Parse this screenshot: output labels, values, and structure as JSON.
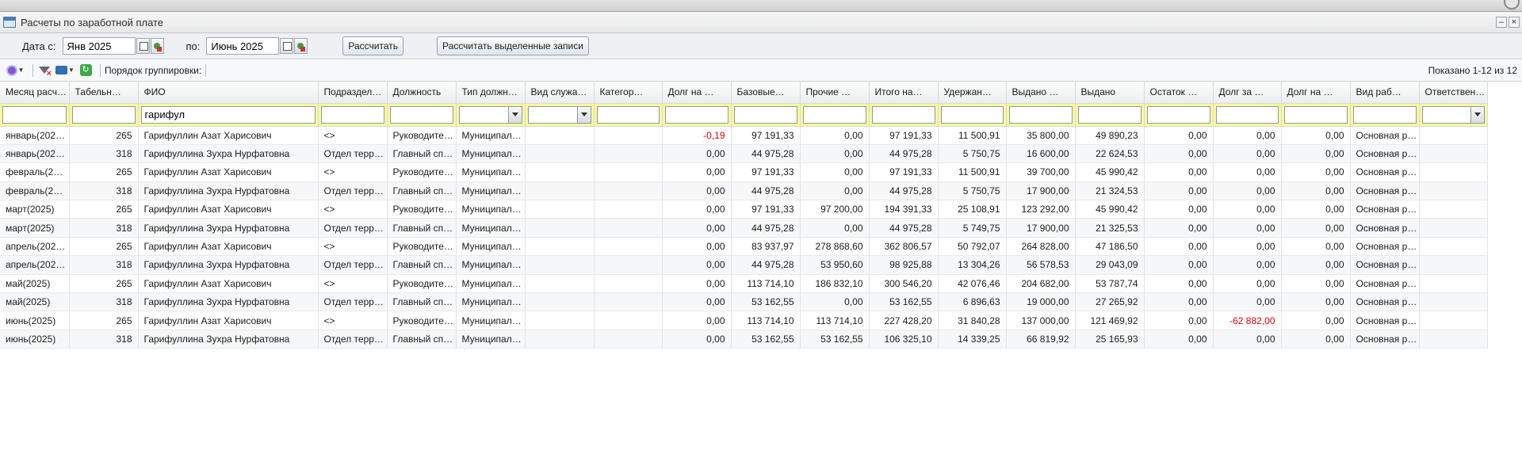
{
  "window": {
    "title": "Расчеты по заработной плате"
  },
  "dates": {
    "from_label": "Дата с:",
    "from_value": "Янв 2025",
    "to_label": "по:",
    "to_value": "Июнь 2025",
    "calc_button": "Рассчитать",
    "calc_selected_button": "Рассчитать выделенные записи"
  },
  "toolbar": {
    "grouping_label": "Порядок группировки:",
    "shown": "Показано 1-12 из 12"
  },
  "columns": [
    {
      "label": "Месяц расч…",
      "filter": "text",
      "value": ""
    },
    {
      "label": "Табельн…",
      "filter": "text",
      "value": ""
    },
    {
      "label": "ФИО",
      "filter": "text",
      "value": "гарифул"
    },
    {
      "label": "Подраздел…",
      "filter": "text",
      "value": ""
    },
    {
      "label": "Должность",
      "filter": "text",
      "value": ""
    },
    {
      "label": "Тип должн…",
      "filter": "select",
      "value": ""
    },
    {
      "label": "Вид служа…",
      "filter": "select",
      "value": ""
    },
    {
      "label": "Категор…",
      "filter": "text",
      "value": ""
    },
    {
      "label": "Долг на …",
      "filter": "text",
      "value": ""
    },
    {
      "label": "Базовые…",
      "filter": "text",
      "value": ""
    },
    {
      "label": "Прочие …",
      "filter": "text",
      "value": ""
    },
    {
      "label": "Итого на…",
      "filter": "text",
      "value": ""
    },
    {
      "label": "Удержан…",
      "filter": "text",
      "value": ""
    },
    {
      "label": "Выдано …",
      "filter": "text",
      "value": ""
    },
    {
      "label": "Выдано",
      "filter": "text",
      "value": ""
    },
    {
      "label": "Остаток …",
      "filter": "text",
      "value": ""
    },
    {
      "label": "Долг за …",
      "filter": "text",
      "value": ""
    },
    {
      "label": "Долг на …",
      "filter": "text",
      "value": ""
    },
    {
      "label": "Вид раб…",
      "filter": "text",
      "value": ""
    },
    {
      "label": "Ответствен…",
      "filter": "select",
      "value": ""
    }
  ],
  "rows": [
    [
      "январь(202…",
      "265",
      "Гарифуллин Азат Харисович",
      "<>",
      "Руководите…",
      "Муниципал…",
      "",
      "",
      "-0,19",
      "97 191,33",
      "0,00",
      "97 191,33",
      "11 500,91",
      "35 800,00",
      "49 890,23",
      "0,00",
      "0,00",
      "0,00",
      "Основная р…",
      ""
    ],
    [
      "январь(202…",
      "318",
      "Гарифуллина Зухра Нурфатовна",
      "Отдел терр…",
      "Главный сп…",
      "Муниципал…",
      "",
      "",
      "0,00",
      "44 975,28",
      "0,00",
      "44 975,28",
      "5 750,75",
      "16 600,00",
      "22 624,53",
      "0,00",
      "0,00",
      "0,00",
      "Основная р…",
      ""
    ],
    [
      "февраль(2…",
      "265",
      "Гарифуллин Азат Харисович",
      "<>",
      "Руководите…",
      "Муниципал…",
      "",
      "",
      "0,00",
      "97 191,33",
      "0,00",
      "97 191,33",
      "11 500,91",
      "39 700,00",
      "45 990,42",
      "0,00",
      "0,00",
      "0,00",
      "Основная р…",
      ""
    ],
    [
      "февраль(2…",
      "318",
      "Гарифуллина Зухра Нурфатовна",
      "Отдел терр…",
      "Главный сп…",
      "Муниципал…",
      "",
      "",
      "0,00",
      "44 975,28",
      "0,00",
      "44 975,28",
      "5 750,75",
      "17 900,00",
      "21 324,53",
      "0,00",
      "0,00",
      "0,00",
      "Основная р…",
      ""
    ],
    [
      "март(2025)",
      "265",
      "Гарифуллин Азат Харисович",
      "<>",
      "Руководите…",
      "Муниципал…",
      "",
      "",
      "0,00",
      "97 191,33",
      "97 200,00",
      "194 391,33",
      "25 108,91",
      "123 292,00",
      "45 990,42",
      "0,00",
      "0,00",
      "0,00",
      "Основная р…",
      ""
    ],
    [
      "март(2025)",
      "318",
      "Гарифуллина Зухра Нурфатовна",
      "Отдел терр…",
      "Главный сп…",
      "Муниципал…",
      "",
      "",
      "0,00",
      "44 975,28",
      "0,00",
      "44 975,28",
      "5 749,75",
      "17 900,00",
      "21 325,53",
      "0,00",
      "0,00",
      "0,00",
      "Основная р…",
      ""
    ],
    [
      "апрель(202…",
      "265",
      "Гарифуллин Азат Харисович",
      "<>",
      "Руководите…",
      "Муниципал…",
      "",
      "",
      "0,00",
      "83 937,97",
      "278 868,60",
      "362 806,57",
      "50 792,07",
      "264 828,00",
      "47 186,50",
      "0,00",
      "0,00",
      "0,00",
      "Основная р…",
      ""
    ],
    [
      "апрель(202…",
      "318",
      "Гарифуллина Зухра Нурфатовна",
      "Отдел терр…",
      "Главный сп…",
      "Муниципал…",
      "",
      "",
      "0,00",
      "44 975,28",
      "53 950,60",
      "98 925,88",
      "13 304,26",
      "56 578,53",
      "29 043,09",
      "0,00",
      "0,00",
      "0,00",
      "Основная р…",
      ""
    ],
    [
      "май(2025)",
      "265",
      "Гарифуллин Азат Харисович",
      "<>",
      "Руководите…",
      "Муниципал…",
      "",
      "",
      "0,00",
      "113 714,10",
      "186 832,10",
      "300 546,20",
      "42 076,46",
      "204 682,00",
      "53 787,74",
      "0,00",
      "0,00",
      "0,00",
      "Основная р…",
      ""
    ],
    [
      "май(2025)",
      "318",
      "Гарифуллина Зухра Нурфатовна",
      "Отдел терр…",
      "Главный сп…",
      "Муниципал…",
      "",
      "",
      "0,00",
      "53 162,55",
      "0,00",
      "53 162,55",
      "6 896,63",
      "19 000,00",
      "27 265,92",
      "0,00",
      "0,00",
      "0,00",
      "Основная р…",
      ""
    ],
    [
      "июнь(2025)",
      "265",
      "Гарифуллин Азат Харисович",
      "<>",
      "Руководите…",
      "Муниципал…",
      "",
      "",
      "0,00",
      "113 714,10",
      "113 714,10",
      "227 428,20",
      "31 840,28",
      "137 000,00",
      "121 469,92",
      "0,00",
      "-62 882,00",
      "0,00",
      "Основная р…",
      ""
    ],
    [
      "июнь(2025)",
      "318",
      "Гарифуллина Зухра Нурфатовна",
      "Отдел терр…",
      "Главный сп…",
      "Муниципал…",
      "",
      "",
      "0,00",
      "53 162,55",
      "53 162,55",
      "106 325,10",
      "14 339,25",
      "66 819,92",
      "25 165,93",
      "0,00",
      "0,00",
      "0,00",
      "Основная р…",
      ""
    ]
  ],
  "colors": {
    "filter_bg": "#fbf99a",
    "negative": "#dd0000",
    "title_icon": "#4a7bb5"
  },
  "icons": [
    "settings-icon",
    "clear-filter-icon",
    "print-icon",
    "refresh-icon",
    "calendar-icon",
    "clear-date-icon",
    "window-icon",
    "minimize-icon",
    "close-icon",
    "dropdown-icon"
  ]
}
